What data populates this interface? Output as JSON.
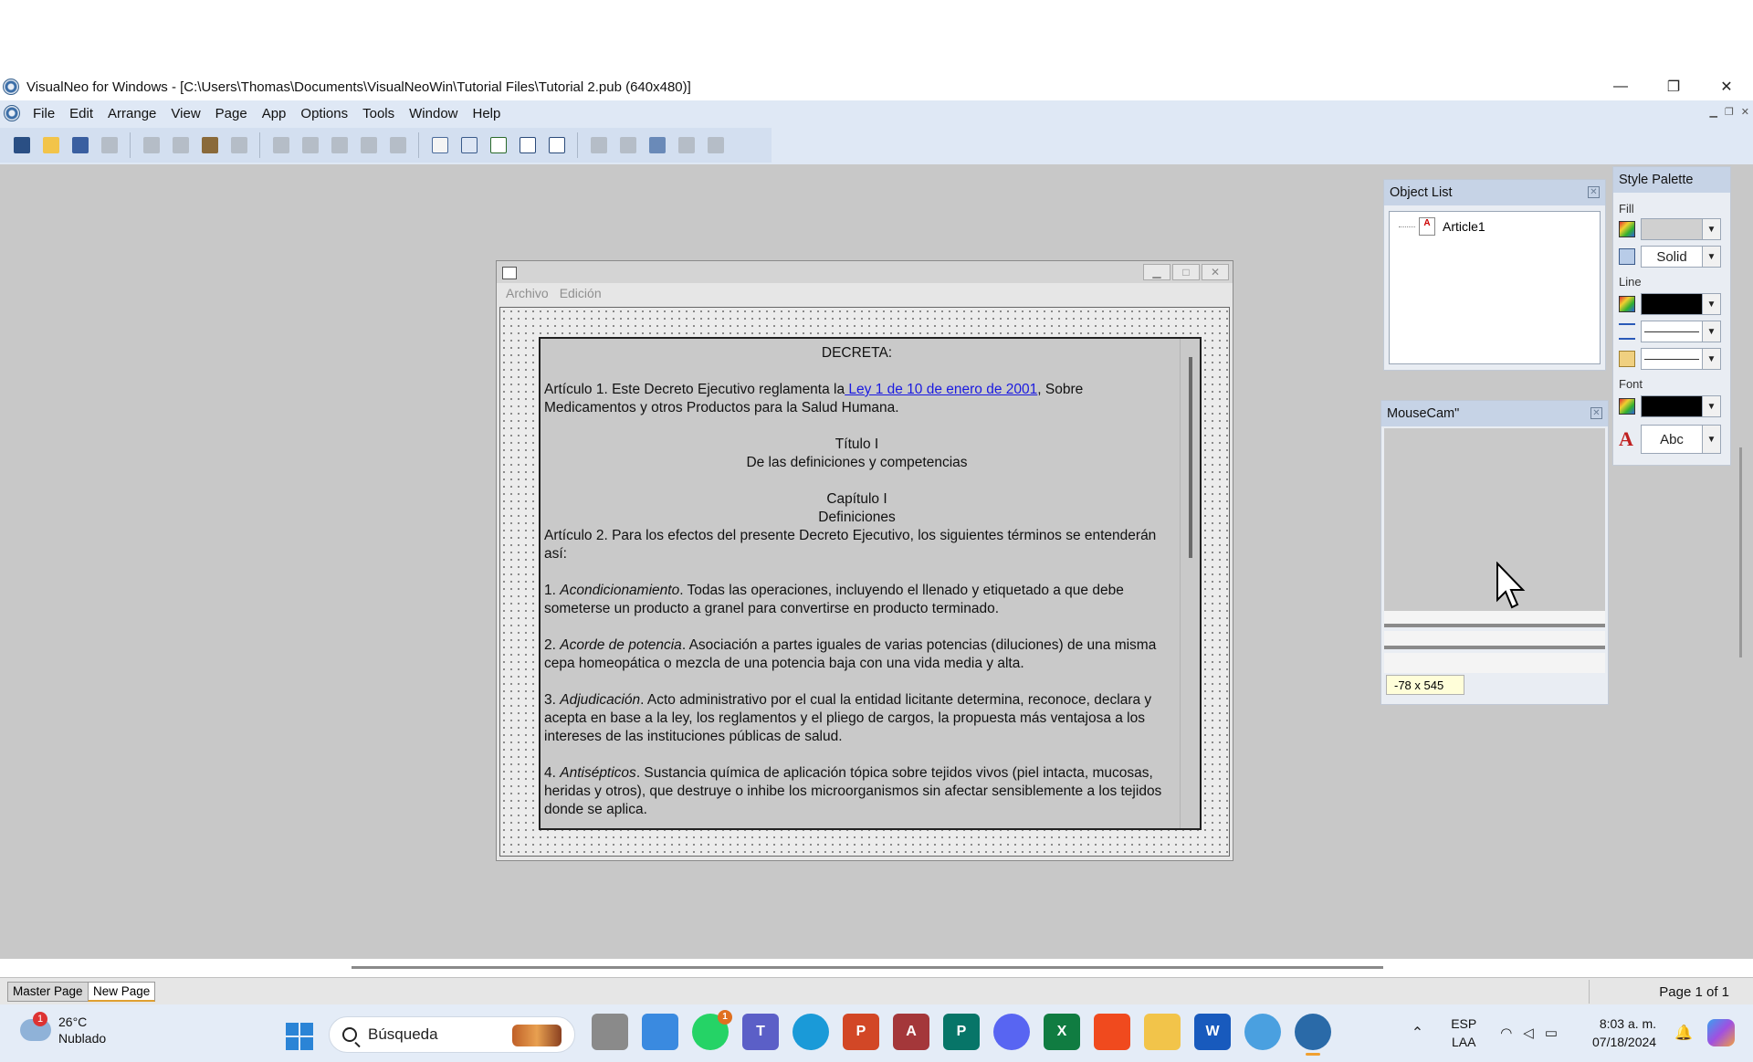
{
  "window": {
    "title": "VisualNeo for Windows - [C:\\Users\\Thomas\\Documents\\VisualNeoWin\\Tutorial Files\\Tutorial 2.pub (640x480)]",
    "minimize": "—",
    "maximize": "❐",
    "close": "✕"
  },
  "menubar": {
    "items": [
      "File",
      "Edit",
      "Arrange",
      "View",
      "Page",
      "App",
      "Options",
      "Tools",
      "Window",
      "Help"
    ]
  },
  "toolbar": {
    "icons": [
      "new-book-icon",
      "open-icon",
      "save-icon",
      "format-painter-icon",
      "cut-icon",
      "copy-icon",
      "paste-icon",
      "delete-icon",
      "group-icon",
      "ungroup-icon",
      "align-icon",
      "bring-front-icon",
      "select-all-icon",
      "new-page-icon",
      "properties-icon",
      "run-icon",
      "run-page-icon",
      "compile-icon",
      "first-page-icon",
      "prev-page-icon",
      "goto-page-icon",
      "next-page-icon",
      "last-page-icon"
    ]
  },
  "doc_window": {
    "menu": [
      "Archivo",
      "Edición"
    ],
    "article": {
      "heading": "DECRETA:",
      "art1_pre": "Artículo 1. Este Decreto Ejecutivo reglamenta la",
      "art1_link": " Ley 1 de 10 de enero de 2001",
      "art1_post": ", Sobre Medicamentos y otros Productos para la Salud Humana.",
      "titulo": "Título I",
      "titulo_sub": "De las definiciones y competencias",
      "capitulo": "Capítulo I",
      "capitulo_sub": "Definiciones",
      "art2": "Artículo 2. Para los efectos del presente Decreto Ejecutivo, los siguientes términos se entenderán así:",
      "def1_num": "1. ",
      "def1_term": "Acondicionamiento",
      "def1_text": ". Todas las operaciones, incluyendo el llenado y etiquetado a que debe someterse un producto a granel para convertirse en producto terminado.",
      "def2_num": "2. ",
      "def2_term": "Acorde de potencia",
      "def2_text": ". Asociación a partes iguales de varias potencias (diluciones) de una misma cepa homeopática o mezcla de una potencia baja con una vida media y alta.",
      "def3_num": "3. ",
      "def3_term": "Adjudicación",
      "def3_text": ". Acto administrativo por el cual la entidad licitante determina, reconoce, declara y acepta en base a la ley, los reglamentos y el pliego de cargos, la propuesta más ventajosa a los intereses de las instituciones públicas de salud.",
      "def4_num": "4. ",
      "def4_term": "Antisépticos",
      "def4_text": ". Sustancia química de aplicación tópica sobre tejidos vivos (piel intacta, mucosas, heridas y otros), que destruye o inhibe los microorganismos sin afectar sensiblemente a los tejidos donde se aplica."
    }
  },
  "object_list": {
    "title": "Object List",
    "items": [
      "Article1"
    ]
  },
  "mousecam": {
    "title": "MouseCam\"",
    "coords": "-78 x 545"
  },
  "style_palette": {
    "title": "Style Palette",
    "fill_label": "Fill",
    "fill_pattern": "Solid",
    "line_label": "Line",
    "font_label": "Font",
    "font_sample": "Abc"
  },
  "page_tabs": {
    "tabs": [
      "Master Page",
      "New Page"
    ],
    "active": "New Page",
    "indicator": "Page 1 of 1"
  },
  "taskbar": {
    "weather_temp": "26°C",
    "weather_desc": "Nublado",
    "weather_badge": "1",
    "search_placeholder": "Búsqueda",
    "whatsapp_badge": "1",
    "lang_top": "ESP",
    "lang_bottom": "LAA",
    "time": "8:03 a. m.",
    "date": "07/18/2024"
  },
  "colors": {
    "workspace": "#c8c8c8",
    "menubar": "#dfe8f5",
    "link": "#1a1ae0"
  }
}
